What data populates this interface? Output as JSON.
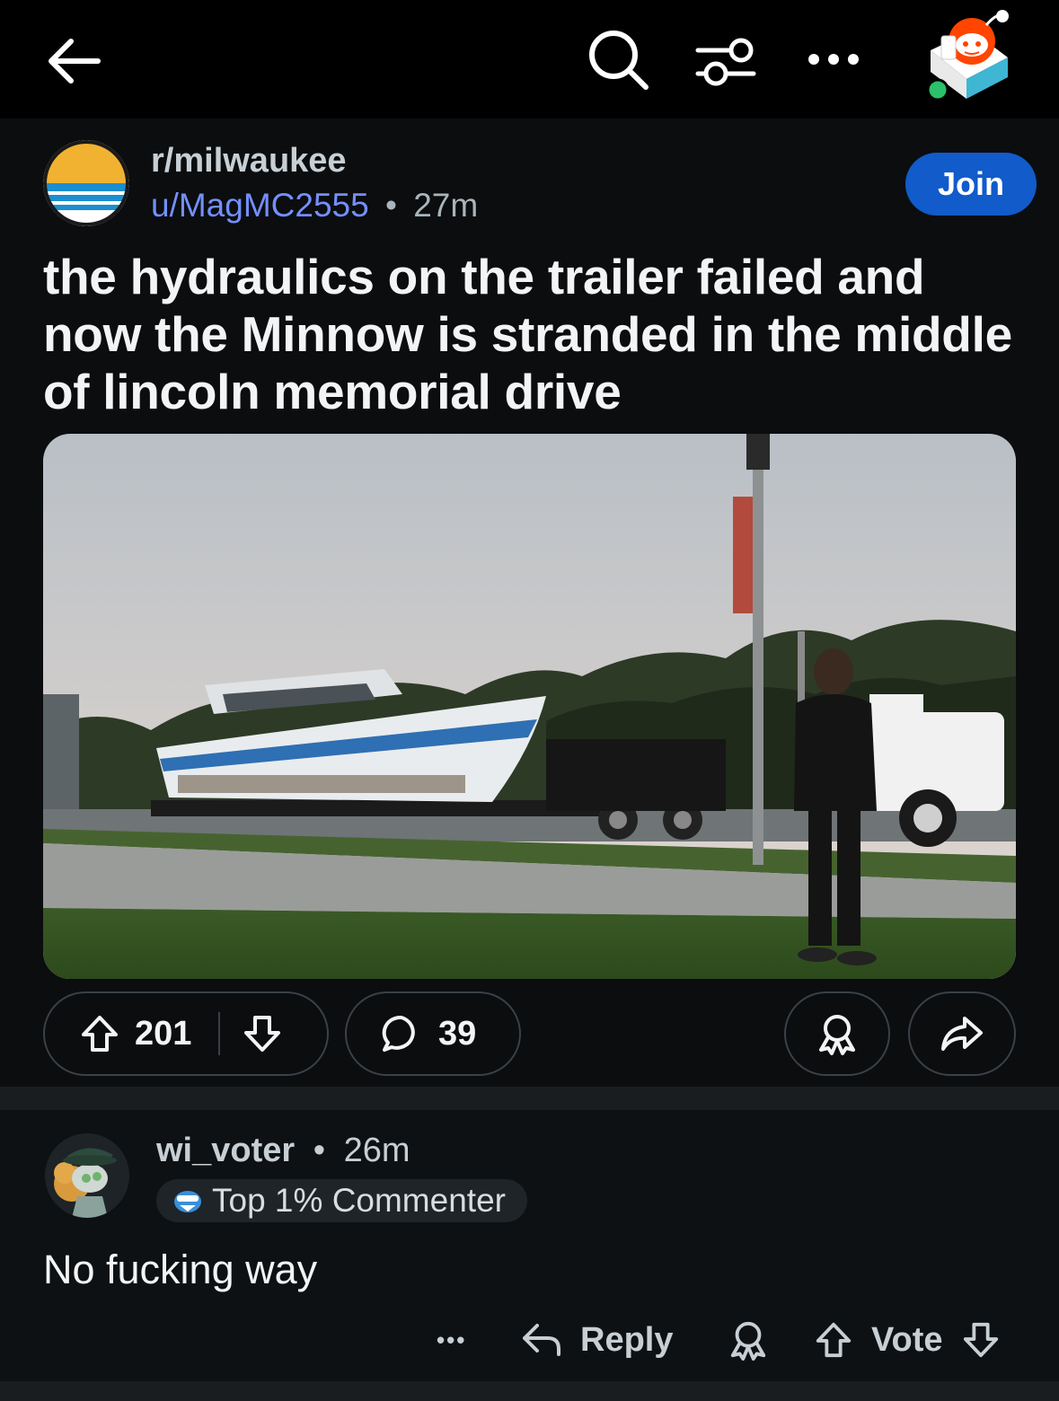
{
  "topbar": {
    "icons": [
      "back-arrow-icon",
      "search-icon",
      "filter-icon",
      "more-icon",
      "user-avatar"
    ]
  },
  "post": {
    "subreddit": "r/milwaukee",
    "author": "u/MagMC2555",
    "separator": "•",
    "age": "27m",
    "join_label": "Join",
    "title": "the hydraulics on the trailer failed and now the Minnow is stranded in the middle of lincoln memorial drive",
    "upvotes": "201",
    "comments": "39"
  },
  "comment": {
    "author": "wi_voter",
    "separator": "•",
    "age": "26m",
    "flair": "Top 1% Commenter",
    "body": "No fucking way",
    "more_label": "•••",
    "reply_label": "Reply",
    "vote_label": "Vote"
  },
  "colors": {
    "background": "#0b0d0f",
    "join_button": "#115bca",
    "username": "#748ffc",
    "online": "#2bc06a",
    "avatar_accent": "#ff4500"
  }
}
